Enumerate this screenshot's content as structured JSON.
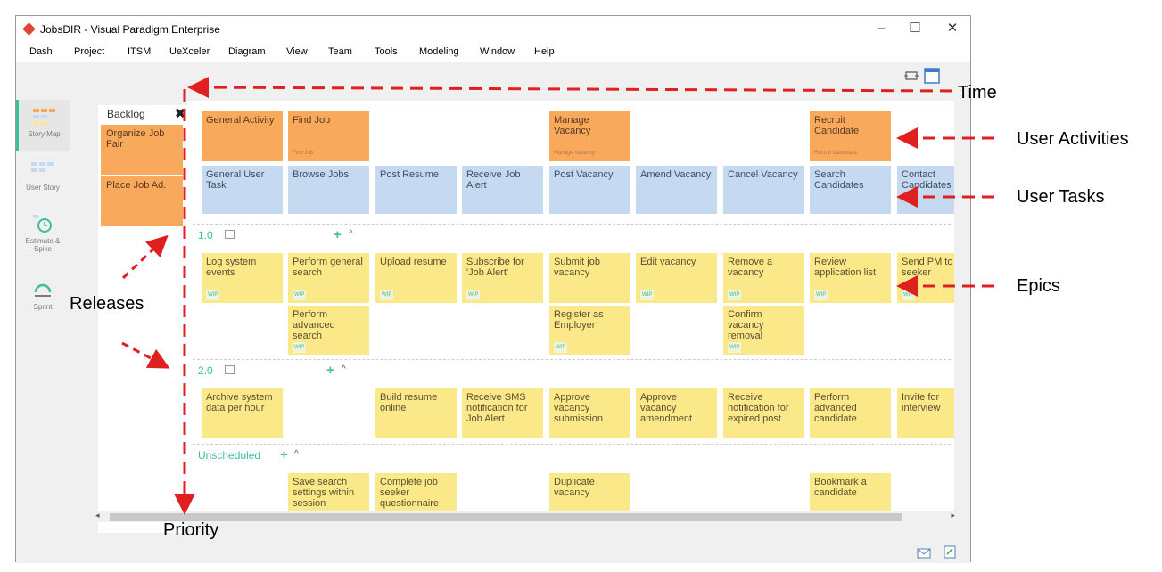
{
  "window": {
    "title": "JobsDIR - Visual Paradigm Enterprise",
    "controls": [
      "–",
      "☐",
      "✕"
    ]
  },
  "menu": [
    "Dash",
    "Project",
    "ITSM",
    "UeXceler",
    "Diagram",
    "View",
    "Team",
    "Tools",
    "Modeling",
    "Window",
    "Help"
  ],
  "nav": [
    {
      "label": "Story Map",
      "icon": "story-map-icon",
      "active": true
    },
    {
      "label": "User Story",
      "icon": "user-story-icon"
    },
    {
      "label": "Estimate & Spike",
      "icon": "estimate-spike-icon"
    },
    {
      "label": "Sprint",
      "icon": "sprint-icon"
    }
  ],
  "backlog": {
    "title": "Backlog",
    "close": "✖",
    "cards": [
      "Organize Job Fair",
      "Place Job Ad."
    ]
  },
  "activities": [
    {
      "label": "General Activity",
      "sub": ""
    },
    {
      "label": "Find Job",
      "sub": "Find Job"
    },
    {
      "label": "Manage Vacancy",
      "sub": "Manage Vacancy"
    },
    {
      "label": "Recruit Candidate",
      "sub": "Recruit Candidate"
    }
  ],
  "tasks": [
    "General User Task",
    "Browse Jobs",
    "Post Resume",
    "Receive Job Alert",
    "Post Vacancy",
    "Amend Vacancy",
    "Cancel Vacancy",
    "Search Candidates",
    "Contact Candidates"
  ],
  "releases": [
    {
      "name": "1.0",
      "rows": [
        [
          "Log system events",
          "Perform general search",
          "Upload resume",
          "Subscribe for 'Job Alert'",
          "Submit job vacancy",
          "Edit vacancy",
          "Remove a vacancy",
          "Review application list",
          "Send PM to seeker"
        ],
        [
          "",
          "Perform advanced search",
          "",
          "",
          "Register as Employer",
          "",
          "Confirm vacancy removal",
          "",
          ""
        ]
      ]
    },
    {
      "name": "2.0",
      "rows": [
        [
          "Archive system data per hour",
          "",
          "Build resume online",
          "Receive SMS notification for Job Alert",
          "Approve vacancy submission",
          "Approve vacancy amendment",
          "Receive notification for expired post",
          "Perform advanced candidate",
          "Invite for interview"
        ]
      ]
    }
  ],
  "unscheduled": {
    "name": "Unscheduled",
    "cards": [
      "",
      "Save search settings within session",
      "Complete job seeker questionnaire",
      "",
      "Duplicate vacancy",
      "",
      "",
      "Bookmark a candidate",
      ""
    ]
  },
  "wip_label": "WIP",
  "annotations": {
    "time": "Time",
    "user_activities": "User Activities",
    "user_tasks": "User Tasks",
    "epics": "Epics",
    "releases": "Releases",
    "priority": "Priority"
  },
  "colors": {
    "activity": "#f9a95c",
    "task": "#c5d9f1",
    "epic": "#fbe889",
    "accent": "#3bbf9c",
    "arrow": "#e02020"
  }
}
